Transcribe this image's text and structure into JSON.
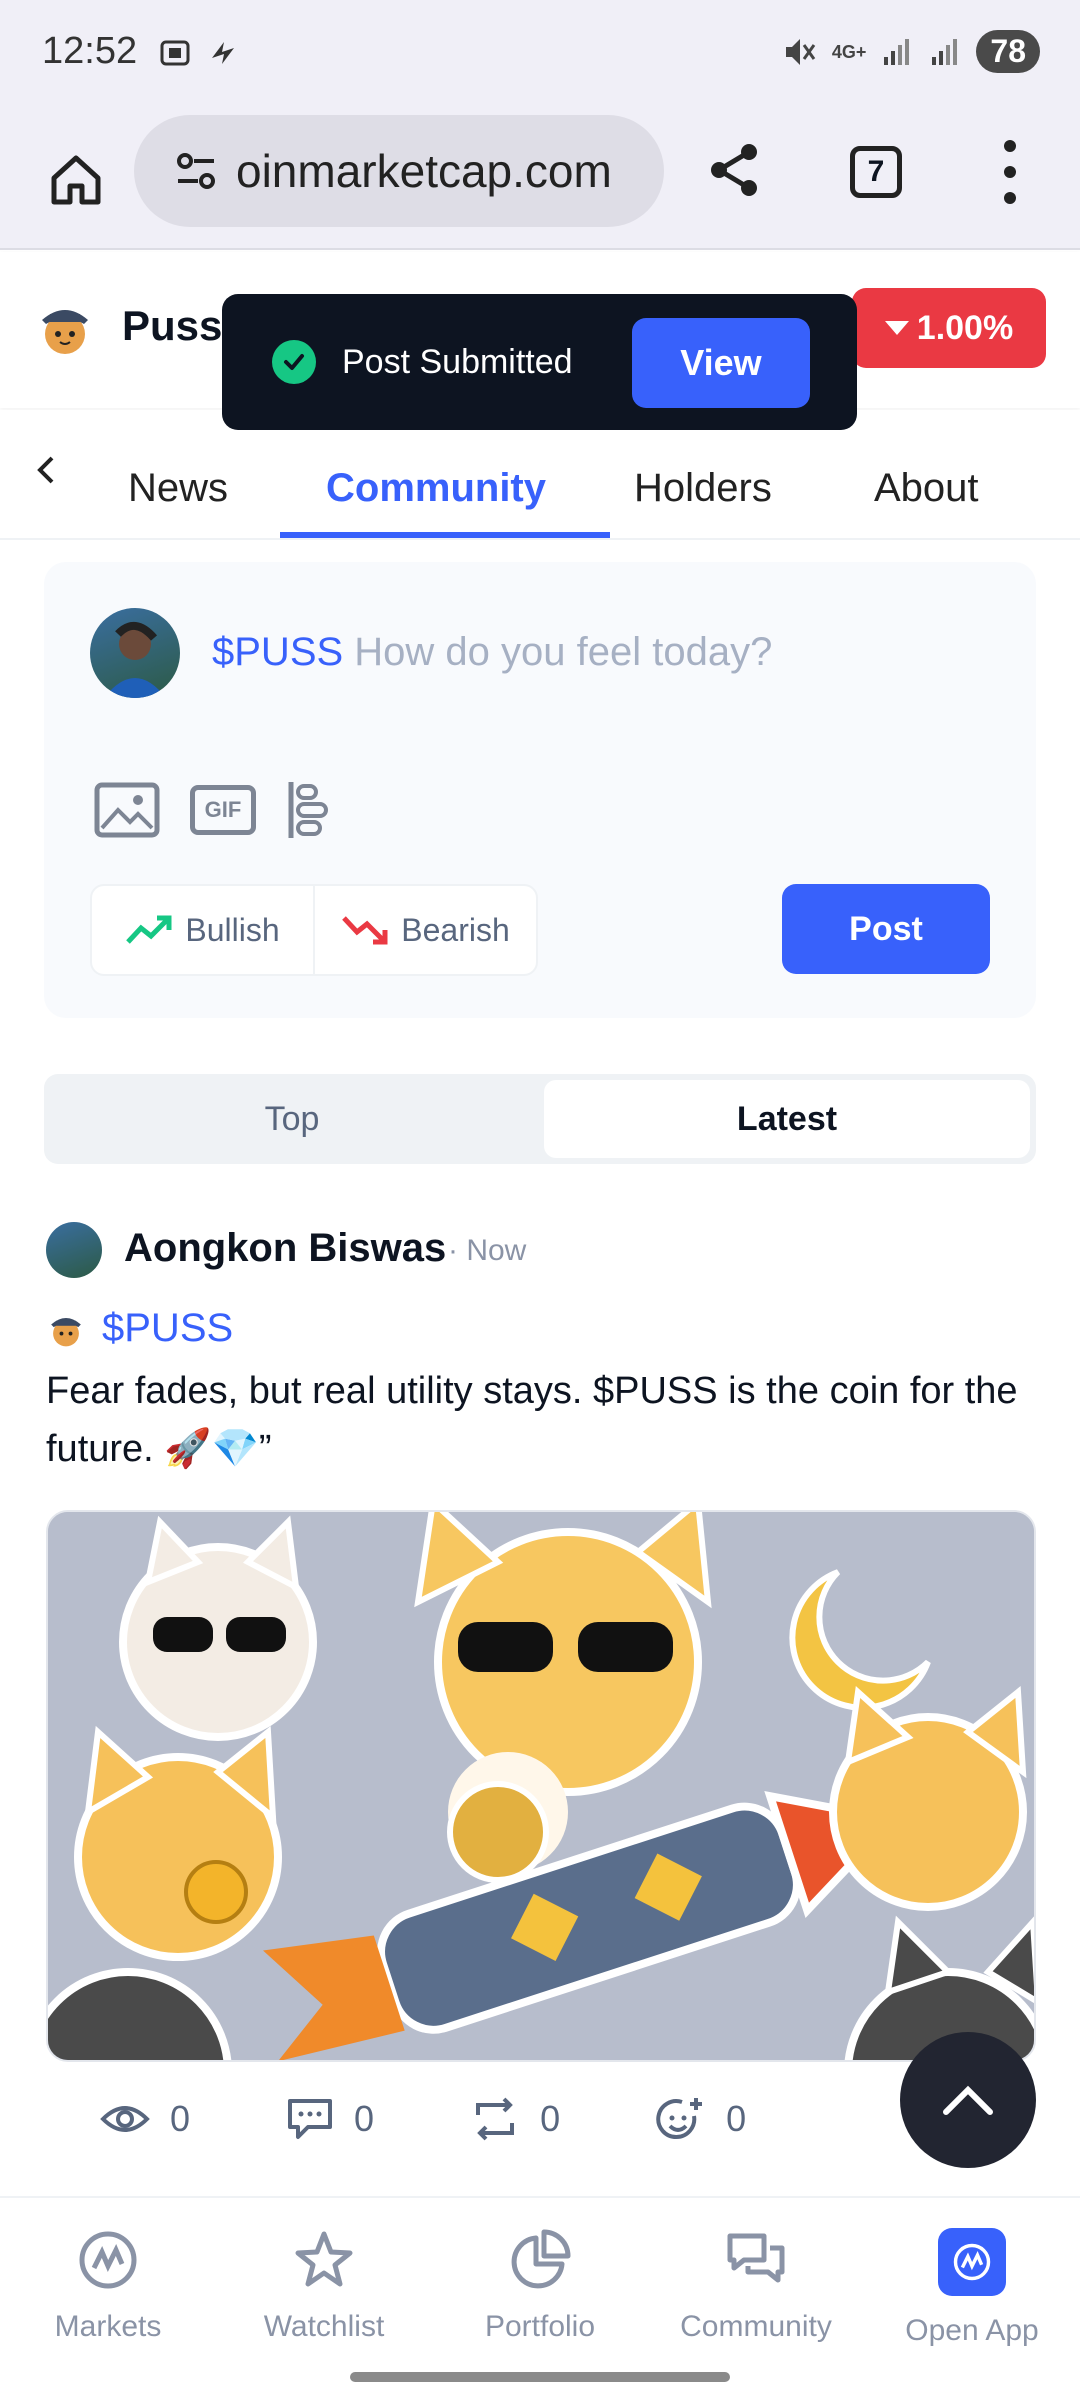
{
  "status_bar": {
    "time": "12:52",
    "network": "4G+",
    "battery": "78"
  },
  "browser": {
    "url": "oinmarketcap.com",
    "tab_count": "7"
  },
  "coin_header": {
    "name": "Puss",
    "change": "1.00%",
    "change_color": "#ea3943"
  },
  "toast": {
    "message": "Post Submitted",
    "action": "View"
  },
  "tabs": {
    "items": [
      "News",
      "Community",
      "Holders",
      "About"
    ],
    "active": "Community"
  },
  "composer": {
    "ticker": "$PUSS",
    "placeholder": "How do you feel today?",
    "bullish": "Bullish",
    "bearish": "Bearish",
    "post": "Post"
  },
  "feed_sort": {
    "top": "Top",
    "latest": "Latest",
    "selected": "Latest"
  },
  "post": {
    "author": "Aongkon Biswas",
    "time": "· Now",
    "ticker": "$PUSS",
    "body": "Fear fades, but real utility stays. $PUSS is the coin for the future. 🚀💎”",
    "views": "0",
    "comments": "0",
    "reposts": "0",
    "reactions": "0"
  },
  "bottom_nav": {
    "markets": "Markets",
    "watchlist": "Watchlist",
    "portfolio": "Portfolio",
    "community": "Community",
    "open_app": "Open App"
  },
  "colors": {
    "accent": "#3861fb",
    "bullish": "#16c784",
    "bearish": "#ea3943"
  }
}
